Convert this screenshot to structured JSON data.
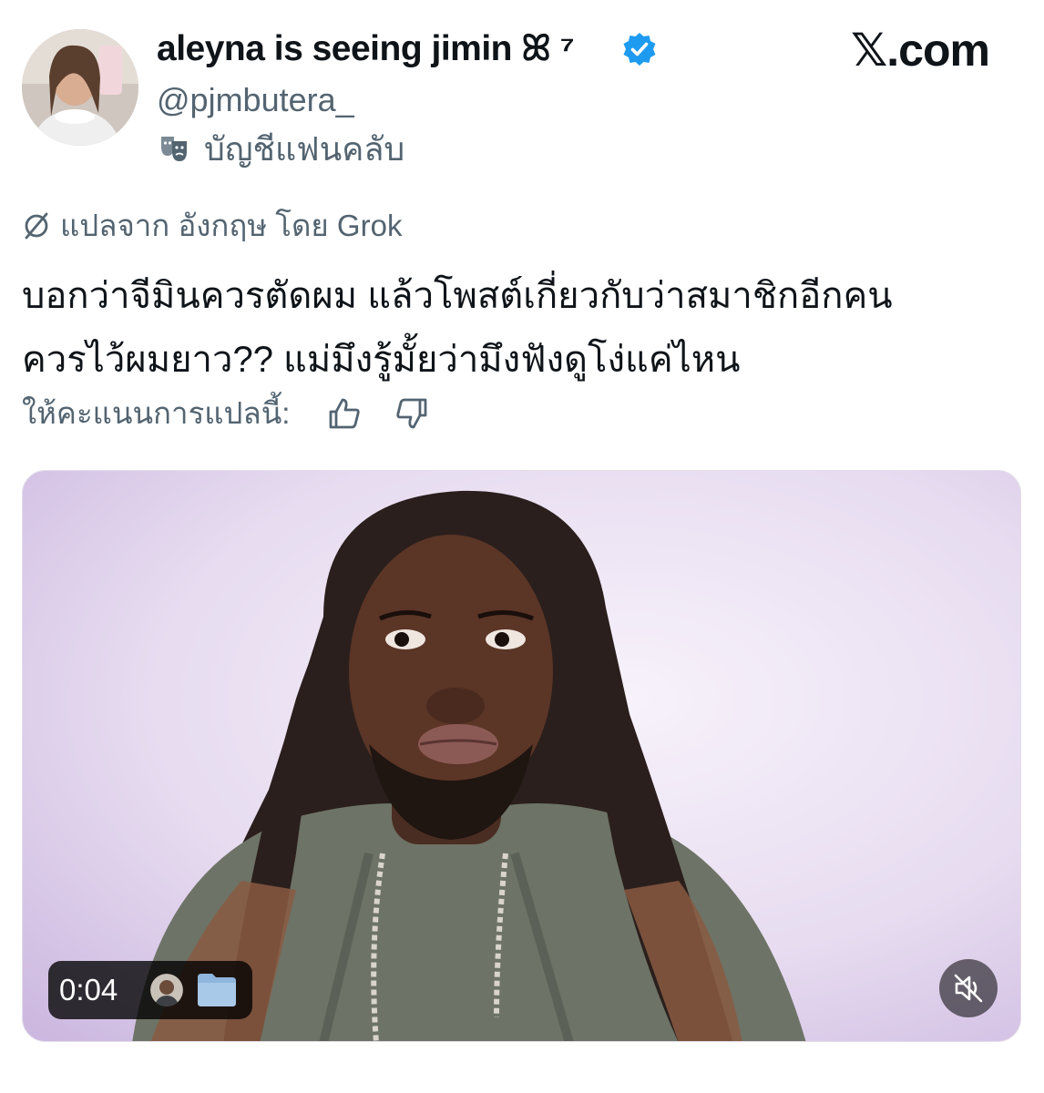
{
  "profile": {
    "display_name": "aleyna is seeing jimin ꕤ ⁷",
    "handle": "@pjmbutera_",
    "badge_label": "บัญชีแฟนคลับ",
    "verified": true,
    "verified_color": "#1d9bf0"
  },
  "brand": {
    "site": "𝕏.com"
  },
  "translation": {
    "note": "แปลจาก อังกฤษ โดย Grok",
    "rate_label": "ให้คะแนนการแปลนี้:"
  },
  "tweet": {
    "line1": "บอกว่าจีมินควรตัดผม แล้วโพสต์เกี่ยวกับว่าสมาชิกอีกคน",
    "line2": "ควรไว้ผมยาว?? แม่มึงรู้มั้ยว่ามึงฟังดูโง่แค่ไหน"
  },
  "video": {
    "timestamp": "0:04",
    "icons": [
      "avatar-icon",
      "folder-icon",
      "mute-icon"
    ]
  },
  "colors": {
    "text_primary": "#0f1419",
    "text_secondary": "#536471",
    "accent": "#1d9bf0",
    "video_background": "#e7dcf0"
  }
}
